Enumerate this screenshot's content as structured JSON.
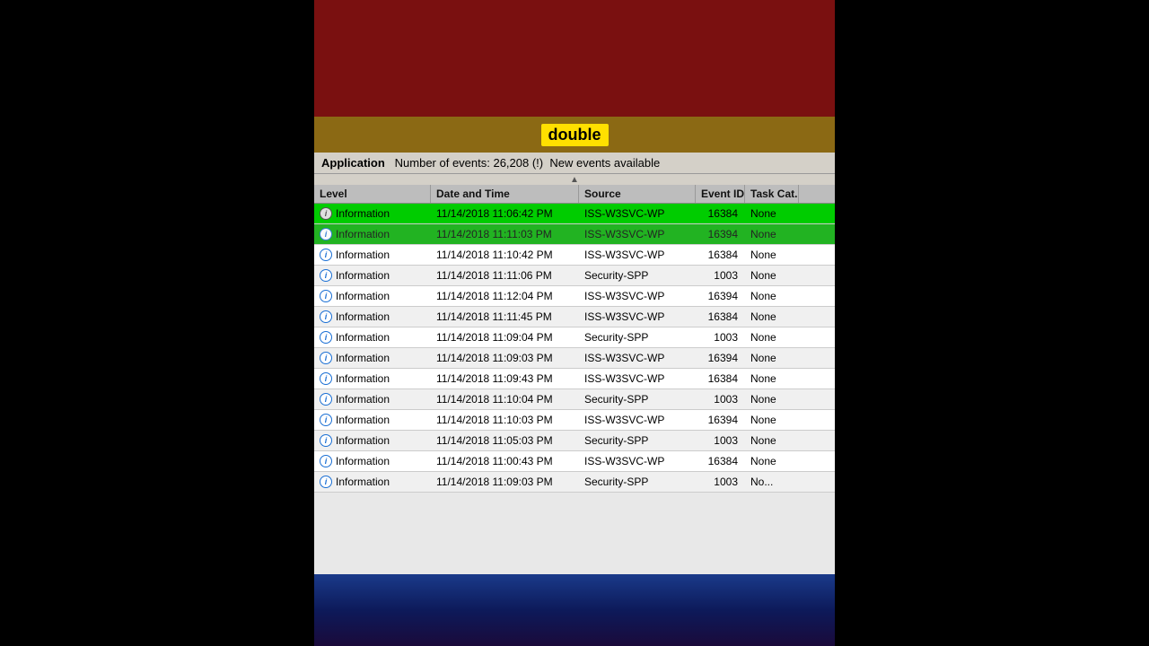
{
  "app": {
    "name": "Application",
    "events_label": "Number of events: 26,208 (!)",
    "new_events": "New events available",
    "double_label": "double"
  },
  "columns": {
    "level": "Level",
    "datetime": "Date and Time",
    "source": "Source",
    "eventid": "Event ID",
    "taskcategory": "Task Cat..."
  },
  "rows": [
    {
      "id": "row-selected",
      "level": "Information",
      "datetime": "11/14/2018 11:06:42 PM",
      "source": "ISS-W3SVC-WP",
      "eventid": "16384",
      "taskcategory": "None",
      "type": "selected"
    },
    {
      "id": "row-partial",
      "level": "Information",
      "datetime": "11/14/2018 11:11:03 PM",
      "source": "ISS-W3SVC-WP",
      "eventid": "16394",
      "taskcategory": "None",
      "type": "partial"
    },
    {
      "id": "row-2",
      "level": "Information",
      "datetime": "11/14/2018 11:10:42 PM",
      "source": "ISS-W3SVC-WP",
      "eventid": "16384",
      "taskcategory": "None",
      "type": "normal"
    },
    {
      "id": "row-3",
      "level": "Information",
      "datetime": "11/14/2018 11:11:06 PM",
      "source": "Security-SPP",
      "eventid": "1003",
      "taskcategory": "None",
      "type": "normal"
    },
    {
      "id": "row-4",
      "level": "Information",
      "datetime": "11/14/2018 11:12:04 PM",
      "source": "ISS-W3SVC-WP",
      "eventid": "16394",
      "taskcategory": "None",
      "type": "normal"
    },
    {
      "id": "row-5",
      "level": "Information",
      "datetime": "11/14/2018 11:11:45 PM",
      "source": "ISS-W3SVC-WP",
      "eventid": "16384",
      "taskcategory": "None",
      "type": "normal"
    },
    {
      "id": "row-6",
      "level": "Information",
      "datetime": "11/14/2018 11:09:04 PM",
      "source": "Security-SPP",
      "eventid": "1003",
      "taskcategory": "None",
      "type": "normal"
    },
    {
      "id": "row-7",
      "level": "Information",
      "datetime": "11/14/2018 11:09:03 PM",
      "source": "ISS-W3SVC-WP",
      "eventid": "16394",
      "taskcategory": "None",
      "type": "normal"
    },
    {
      "id": "row-8",
      "level": "Information",
      "datetime": "11/14/2018 11:09:43 PM",
      "source": "ISS-W3SVC-WP",
      "eventid": "16384",
      "taskcategory": "None",
      "type": "normal"
    },
    {
      "id": "row-9",
      "level": "Information",
      "datetime": "11/14/2018 11:10:04 PM",
      "source": "Security-SPP",
      "eventid": "1003",
      "taskcategory": "None",
      "type": "normal"
    },
    {
      "id": "row-10",
      "level": "Information",
      "datetime": "11/14/2018 11:10:03 PM",
      "source": "ISS-W3SVC-WP",
      "eventid": "16394",
      "taskcategory": "None",
      "type": "normal"
    },
    {
      "id": "row-11",
      "level": "Information",
      "datetime": "11/14/2018 11:05:03 PM",
      "source": "Security-SPP",
      "eventid": "1003",
      "taskcategory": "None",
      "type": "normal"
    },
    {
      "id": "row-12",
      "level": "Information",
      "datetime": "11/14/2018 11:00:43 PM",
      "source": "ISS-W3SVC-WP",
      "eventid": "16384",
      "taskcategory": "None",
      "type": "normal"
    },
    {
      "id": "row-13",
      "level": "Information",
      "datetime": "11/14/2018 11:09:03 PM",
      "source": "Security-SPP",
      "eventid": "1003",
      "taskcategory": "No...",
      "type": "normal"
    }
  ]
}
